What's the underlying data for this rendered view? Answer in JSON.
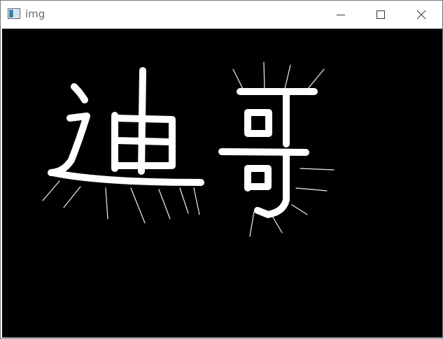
{
  "window": {
    "title": "img",
    "app_icon": "window-app-icon",
    "controls": {
      "minimize": "minimize-icon",
      "maximize": "maximize-icon",
      "close": "close-icon"
    }
  },
  "canvas": {
    "background": "#000000",
    "stroke_color": "#ffffff",
    "handwritten_text": "迪哥"
  }
}
